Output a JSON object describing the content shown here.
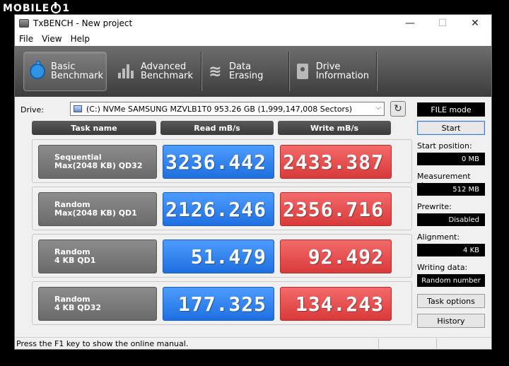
{
  "watermark": {
    "text_before": "MOBILE",
    "text_after": "1"
  },
  "window": {
    "title": "TxBENCH - New project",
    "controls": {
      "minimize": "—",
      "maximize": "☐",
      "close": "✕"
    }
  },
  "menu": [
    "File",
    "View",
    "Help"
  ],
  "toolbar": {
    "tabs": [
      {
        "line1": "Basic",
        "line2": "Benchmark",
        "icon": "stopwatch-icon",
        "active": true
      },
      {
        "line1": "Advanced",
        "line2": "Benchmark",
        "icon": "bar-chart-icon",
        "active": false
      },
      {
        "line1": "Data Erasing",
        "line2": "",
        "icon": "eraser-icon",
        "active": false
      },
      {
        "line1": "Drive",
        "line2": "Information",
        "icon": "drive-icon",
        "active": false
      }
    ]
  },
  "drive": {
    "label": "Drive:",
    "selected": "(C:) NVMe SAMSUNG MZVLB1T0  953.26 GB (1,999,147,008 Sectors)",
    "mode": "FILE mode"
  },
  "results": {
    "headers": {
      "task": "Task name",
      "read": "Read mB/s",
      "write": "Write mB/s"
    },
    "rows": [
      {
        "line1": "Sequential",
        "line2": "Max(2048 KB) QD32",
        "read": "3236.442",
        "write": "2433.387"
      },
      {
        "line1": "Random",
        "line2": "Max(2048 KB) QD1",
        "read": "2126.246",
        "write": "2356.716"
      },
      {
        "line1": "Random",
        "line2": "4 KB QD1",
        "read": "51.479",
        "write": "92.492"
      },
      {
        "line1": "Random",
        "line2": "4 KB QD32",
        "read": "177.325",
        "write": "134.243"
      }
    ]
  },
  "side": {
    "start": "Start",
    "start_position_label": "Start position:",
    "start_position": "0 MB",
    "measurement_size_label": "Measurement size:",
    "measurement_size": "512 MB",
    "prewrite_label": "Prewrite:",
    "prewrite": "Disabled",
    "alignment_label": "Alignment:",
    "alignment": "4 KB",
    "writing_data_label": "Writing data:",
    "writing_data": "Random number",
    "task_options": "Task options",
    "history": "History"
  },
  "status": "Press the F1 key to show the online manual.",
  "colors": {
    "read": "#2a7cf0",
    "write": "#e24b4b",
    "toolbar": "#4a4a4a"
  }
}
